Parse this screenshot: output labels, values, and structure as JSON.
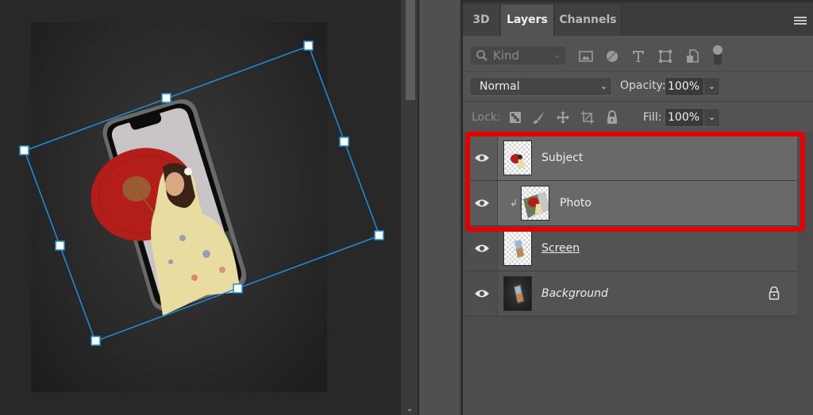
{
  "canvas": {
    "document": "phone mockup with subject (woman in kimono with red umbrella) on dark vignette background",
    "transform_box": "free transform bounding box with 8 handles",
    "accent_color": "#1e8fdc"
  },
  "panel": {
    "tabs": [
      {
        "label": "3D",
        "active": false
      },
      {
        "label": "Layers",
        "active": true
      },
      {
        "label": "Channels",
        "active": false
      }
    ],
    "menu_icon": "panel-menu-icon",
    "filter": {
      "kind_label": "Kind",
      "icons": [
        "pixel-layer-filter-icon",
        "adjustment-layer-filter-icon",
        "type-layer-filter-icon",
        "shape-layer-filter-icon",
        "smart-object-filter-icon",
        "filter-toggle-icon"
      ]
    },
    "blend_mode": "Normal",
    "opacity_label": "Opacity:",
    "opacity_value": "100%",
    "lock_label": "Lock:",
    "lock_icons": [
      "lock-transparent-pixels-icon",
      "lock-image-pixels-icon",
      "lock-position-icon",
      "lock-artboard-icon",
      "lock-all-icon"
    ],
    "fill_label": "Fill:",
    "fill_value": "100%"
  },
  "layers": [
    {
      "name": "Subject",
      "visible": true,
      "selected": true,
      "clipped": false,
      "locked": false,
      "style": "normal"
    },
    {
      "name": "Photo",
      "visible": true,
      "selected": true,
      "clipped": true,
      "locked": false,
      "style": "normal"
    },
    {
      "name": "Screen",
      "visible": true,
      "selected": false,
      "clipped": false,
      "locked": false,
      "style": "underline"
    },
    {
      "name": "Background",
      "visible": true,
      "selected": false,
      "clipped": false,
      "locked": true,
      "style": "italic"
    }
  ],
  "highlight_color": "#e60000",
  "scroll_down_glyph": "⌄"
}
